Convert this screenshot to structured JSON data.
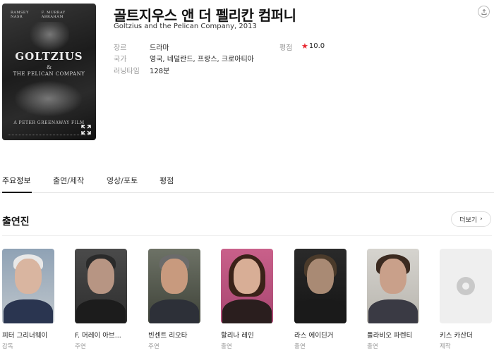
{
  "movie": {
    "title": "골트지우스 앤 더 펠리칸 컴퍼니",
    "subtitle": "Goltzius and the Pelican Company, 2013",
    "poster": {
      "name_left": "RAMSEY NASR",
      "name_right": "F. MURRAY ABRAHAM",
      "title_line1": "GOLTZIUS",
      "title_amp": "&",
      "title_line2": "THE PELICAN COMPANY",
      "credit": "A PETER GREENAWAY FILM"
    },
    "info": {
      "genre_label": "장르",
      "genre_value": "드라마",
      "country_label": "국가",
      "country_value": "영국, 네덜란드, 프랑스, 크로아티아",
      "runtime_label": "러닝타임",
      "runtime_value": "128분",
      "rating_label": "평점",
      "rating_value": "10.0",
      "rating_star": "★"
    }
  },
  "tabs": [
    {
      "label": "주요정보"
    },
    {
      "label": "출연/제작"
    },
    {
      "label": "영상/포토"
    },
    {
      "label": "평점"
    }
  ],
  "cast": {
    "heading": "출연진",
    "more_label": "더보기",
    "more_chevron": "›",
    "members": [
      {
        "name": "피터 그리너웨이",
        "role": "감독"
      },
      {
        "name": "F. 머레이 아브...",
        "role": "주연"
      },
      {
        "name": "빈센트 리오타",
        "role": "주연"
      },
      {
        "name": "할리나 레인",
        "role": "출연"
      },
      {
        "name": "라스 에이딘거",
        "role": "출연"
      },
      {
        "name": "플라비오 파렌티",
        "role": "출연"
      },
      {
        "name": "키스 카산더",
        "role": "제작"
      }
    ]
  },
  "icons": {
    "share": "share-icon",
    "expand": "expand-icon",
    "placeholder": "film-reel-icon"
  }
}
